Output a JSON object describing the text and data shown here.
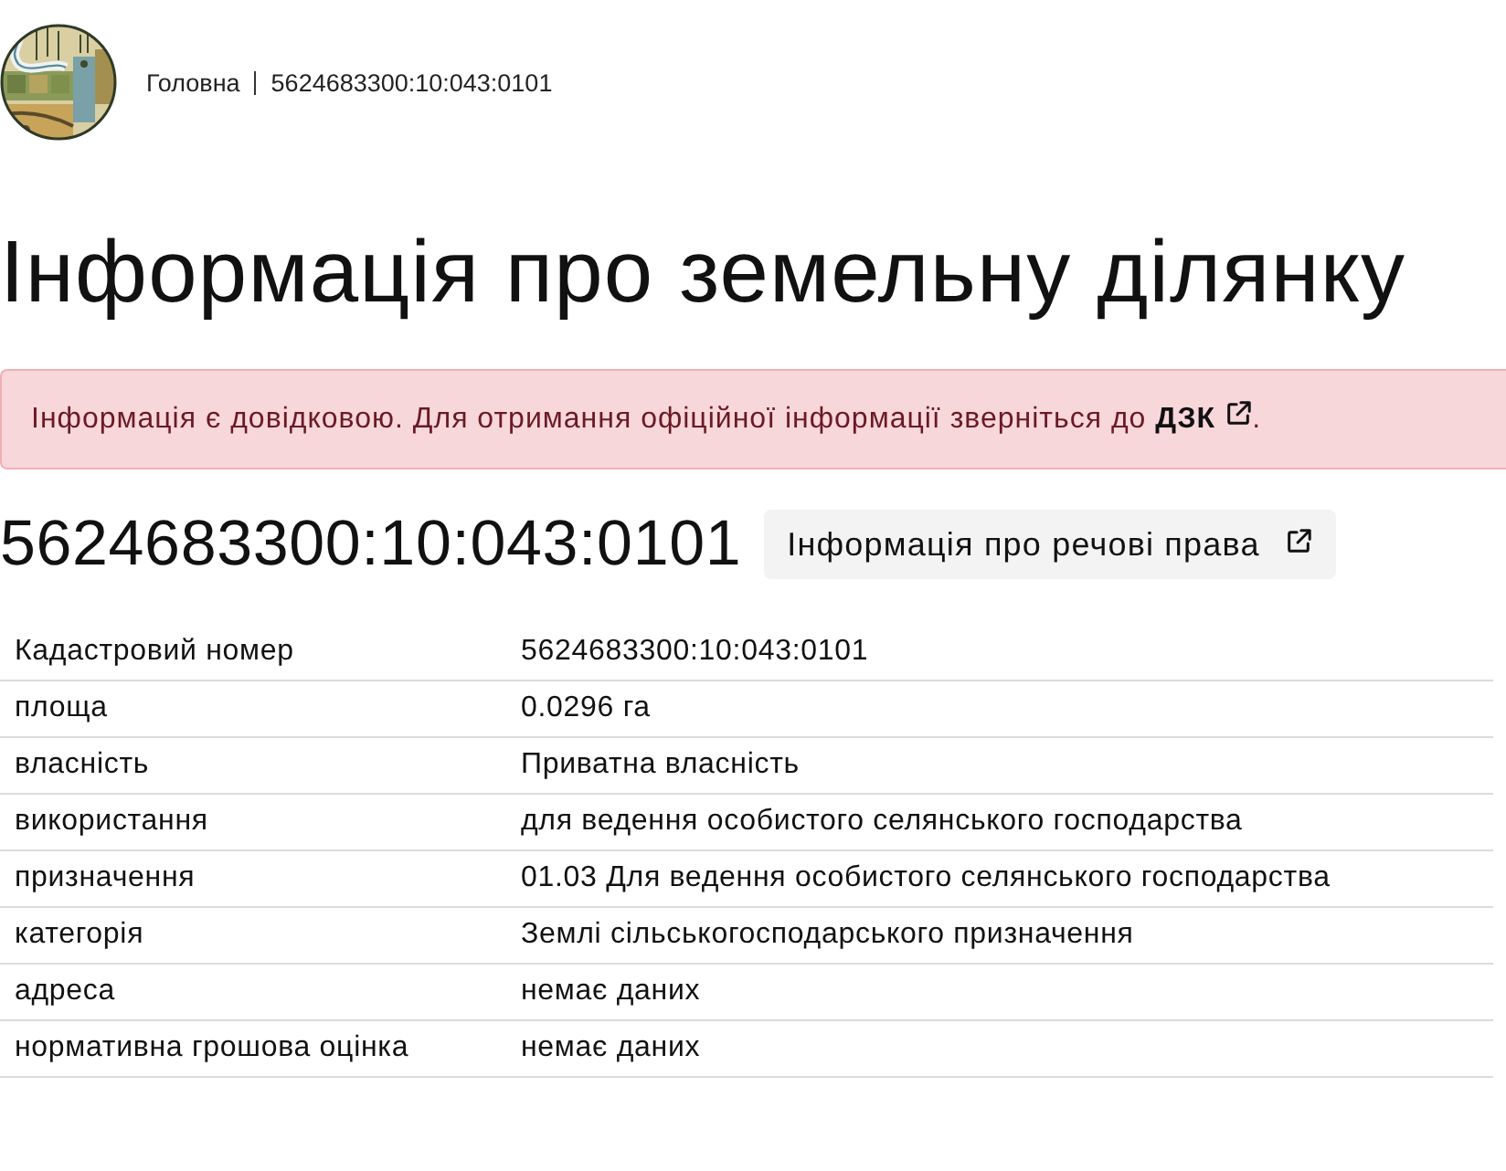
{
  "breadcrumbs": [
    {
      "label": "Головна"
    },
    {
      "label": "5624683300:10:043:0101"
    }
  ],
  "title": "Інформація про земельну ділянку",
  "notice": {
    "text_before": "Інформація є довідковою. Для отримання офіційної інформації зверніться до",
    "link": "ДЗК",
    "text_after": "."
  },
  "parcel_number": "5624683300:10:043:0101",
  "rights_button": {
    "label": "Інформація про речові права"
  },
  "table": {
    "rows": [
      {
        "label": "Кадастровий номер",
        "value": "5624683300:10:043:0101"
      },
      {
        "label": "площа",
        "value": "0.0296 га"
      },
      {
        "label": "власність",
        "value": "Приватна власність"
      },
      {
        "label": "використання",
        "value": "для ведення особистого селянського господарства"
      },
      {
        "label": "призначення",
        "value": "01.03 Для ведення особистого селянського господарства"
      },
      {
        "label": "категорія",
        "value": "Землі сільськогосподарського призначення"
      },
      {
        "label": "адреса",
        "value": "немає даних"
      },
      {
        "label": "нормативна грошова оцінка",
        "value": "немає даних"
      }
    ]
  }
}
